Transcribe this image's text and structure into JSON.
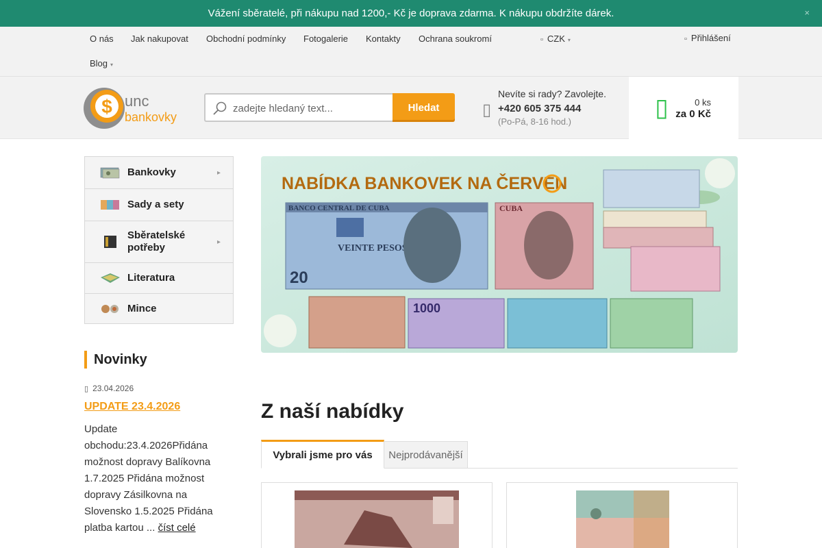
{
  "announcement": {
    "text": "Vážení sběratelé, při nákupu nad 1200,- Kč je doprava zdarma. K nákupu obdržíte dárek.",
    "close_icon": "×"
  },
  "topnav": {
    "items": [
      "O nás",
      "Jak nakupovat",
      "Obchodní podmínky",
      "Fotogalerie",
      "Kontakty",
      "Ochrana soukromí"
    ],
    "blog": "Blog",
    "currency": "CZK",
    "login": "Přihlášení"
  },
  "header": {
    "logo_top": "unc",
    "logo_bottom": "bankovky",
    "search_placeholder": "zadejte hledaný text...",
    "search_button": "Hledat",
    "phone_question": "Nevíte si rady? Zavolejte.",
    "phone_number": "+420 605 375 444",
    "phone_hours": "(Po-Pá, 8-16 hod.)",
    "cart_count": "0 ks",
    "cart_total": "za 0 Kč"
  },
  "categories": [
    {
      "label": "Bankovky",
      "has_submenu": true
    },
    {
      "label": "Sady a sety",
      "has_submenu": false
    },
    {
      "label": "Sběratelské potřeby",
      "has_submenu": true
    },
    {
      "label": "Literatura",
      "has_submenu": false
    },
    {
      "label": "Mince",
      "has_submenu": false
    }
  ],
  "news": {
    "title": "Novinky",
    "date": "23.04.2026",
    "headline": "UPDATE 23.4.2026",
    "text": "Update obchodu:23.4.2026Přidána možnost dopravy Balíkovna 1.7.2025 Přidána možnost dopravy Zásilkovna na Slovensko 1.5.2025 Přidána platba kartou ... ",
    "more": "číst celé"
  },
  "banner": {
    "heading": "NABÍDKA BANKOVEK NA ČERVEN",
    "note_labels": [
      "BANCO CENTRAL DE CUBA",
      "VEINTE PESOS",
      "CUBA",
      "1000"
    ]
  },
  "offer": {
    "title": "Z naší nabídky",
    "tabs": [
      "Vybrali jsme pro vás",
      "Nejprodávanější"
    ]
  },
  "colors": {
    "accent": "#f39c16",
    "announce_bg": "#1f8a70",
    "cart_green": "#2ec24b"
  }
}
